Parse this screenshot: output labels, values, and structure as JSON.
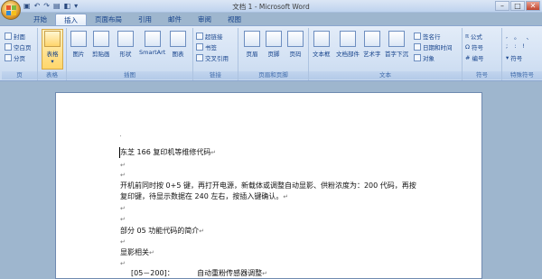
{
  "title": "文档 1 - Microsoft Word",
  "tabs": [
    "开始",
    "插入",
    "页面布局",
    "引用",
    "邮件",
    "审阅",
    "视图"
  ],
  "ribbon": {
    "page": {
      "label": "页",
      "items": [
        "封面",
        "空白页",
        "分页"
      ]
    },
    "table": {
      "label": "表格",
      "button": "表格"
    },
    "illustrations": {
      "label": "插图",
      "items": [
        "图片",
        "剪贴画",
        "形状",
        "SmartArt",
        "图表"
      ]
    },
    "links": {
      "label": "链接",
      "items": [
        "超链接",
        "书签",
        "交叉引用"
      ]
    },
    "header_footer": {
      "label": "页眉和页脚",
      "items": [
        "页眉",
        "页脚",
        "页码"
      ]
    },
    "text": {
      "label": "文本",
      "items": [
        "文本框",
        "文档部件",
        "艺术字",
        "首字下沉"
      ],
      "small": [
        "签名行",
        "日期和时间",
        "对象"
      ]
    },
    "symbols": {
      "label": "符号",
      "items": [
        "公式",
        "符号",
        "编号"
      ]
    },
    "special": {
      "label": "特殊符号",
      "items": [
        ",",
        "。",
        "、",
        ";",
        ":",
        "!",
        "符号"
      ]
    }
  },
  "doc": {
    "lines": [
      "东芝 166 复印机等维修代码",
      "",
      "",
      "开机前同时按 0+5 键，再打开电源，新载体或调整自动显影、供粉浓度为：200 代码，再按",
      "复印键，待显示数据在 240 左右，按插入键确认。",
      "",
      "",
      "部分 05 功能代码的简介",
      "",
      "显影相关",
      "",
      "[05－200]：          自动重粉传感器调整"
    ]
  },
  "colors": {
    "accent": "#15428b",
    "ribbon": "#d4e2f4",
    "doc_bg": "#9eb6ce"
  }
}
